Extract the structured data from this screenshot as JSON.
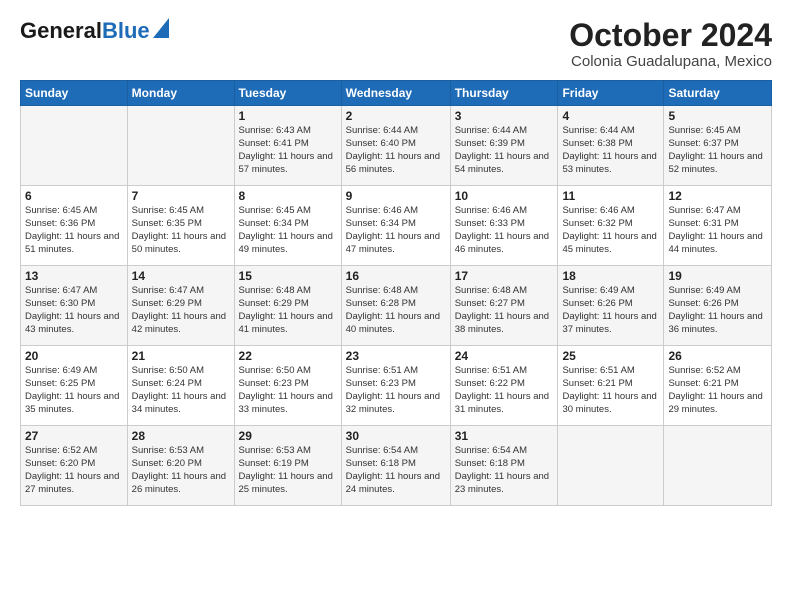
{
  "header": {
    "logo_general": "General",
    "logo_blue": "Blue",
    "main_title": "October 2024",
    "subtitle": "Colonia Guadalupana, Mexico"
  },
  "calendar": {
    "days_of_week": [
      "Sunday",
      "Monday",
      "Tuesday",
      "Wednesday",
      "Thursday",
      "Friday",
      "Saturday"
    ],
    "weeks": [
      [
        {
          "day": "",
          "info": ""
        },
        {
          "day": "",
          "info": ""
        },
        {
          "day": "1",
          "info": "Sunrise: 6:43 AM\nSunset: 6:41 PM\nDaylight: 11 hours and 57 minutes."
        },
        {
          "day": "2",
          "info": "Sunrise: 6:44 AM\nSunset: 6:40 PM\nDaylight: 11 hours and 56 minutes."
        },
        {
          "day": "3",
          "info": "Sunrise: 6:44 AM\nSunset: 6:39 PM\nDaylight: 11 hours and 54 minutes."
        },
        {
          "day": "4",
          "info": "Sunrise: 6:44 AM\nSunset: 6:38 PM\nDaylight: 11 hours and 53 minutes."
        },
        {
          "day": "5",
          "info": "Sunrise: 6:45 AM\nSunset: 6:37 PM\nDaylight: 11 hours and 52 minutes."
        }
      ],
      [
        {
          "day": "6",
          "info": "Sunrise: 6:45 AM\nSunset: 6:36 PM\nDaylight: 11 hours and 51 minutes."
        },
        {
          "day": "7",
          "info": "Sunrise: 6:45 AM\nSunset: 6:35 PM\nDaylight: 11 hours and 50 minutes."
        },
        {
          "day": "8",
          "info": "Sunrise: 6:45 AM\nSunset: 6:34 PM\nDaylight: 11 hours and 49 minutes."
        },
        {
          "day": "9",
          "info": "Sunrise: 6:46 AM\nSunset: 6:34 PM\nDaylight: 11 hours and 47 minutes."
        },
        {
          "day": "10",
          "info": "Sunrise: 6:46 AM\nSunset: 6:33 PM\nDaylight: 11 hours and 46 minutes."
        },
        {
          "day": "11",
          "info": "Sunrise: 6:46 AM\nSunset: 6:32 PM\nDaylight: 11 hours and 45 minutes."
        },
        {
          "day": "12",
          "info": "Sunrise: 6:47 AM\nSunset: 6:31 PM\nDaylight: 11 hours and 44 minutes."
        }
      ],
      [
        {
          "day": "13",
          "info": "Sunrise: 6:47 AM\nSunset: 6:30 PM\nDaylight: 11 hours and 43 minutes."
        },
        {
          "day": "14",
          "info": "Sunrise: 6:47 AM\nSunset: 6:29 PM\nDaylight: 11 hours and 42 minutes."
        },
        {
          "day": "15",
          "info": "Sunrise: 6:48 AM\nSunset: 6:29 PM\nDaylight: 11 hours and 41 minutes."
        },
        {
          "day": "16",
          "info": "Sunrise: 6:48 AM\nSunset: 6:28 PM\nDaylight: 11 hours and 40 minutes."
        },
        {
          "day": "17",
          "info": "Sunrise: 6:48 AM\nSunset: 6:27 PM\nDaylight: 11 hours and 38 minutes."
        },
        {
          "day": "18",
          "info": "Sunrise: 6:49 AM\nSunset: 6:26 PM\nDaylight: 11 hours and 37 minutes."
        },
        {
          "day": "19",
          "info": "Sunrise: 6:49 AM\nSunset: 6:26 PM\nDaylight: 11 hours and 36 minutes."
        }
      ],
      [
        {
          "day": "20",
          "info": "Sunrise: 6:49 AM\nSunset: 6:25 PM\nDaylight: 11 hours and 35 minutes."
        },
        {
          "day": "21",
          "info": "Sunrise: 6:50 AM\nSunset: 6:24 PM\nDaylight: 11 hours and 34 minutes."
        },
        {
          "day": "22",
          "info": "Sunrise: 6:50 AM\nSunset: 6:23 PM\nDaylight: 11 hours and 33 minutes."
        },
        {
          "day": "23",
          "info": "Sunrise: 6:51 AM\nSunset: 6:23 PM\nDaylight: 11 hours and 32 minutes."
        },
        {
          "day": "24",
          "info": "Sunrise: 6:51 AM\nSunset: 6:22 PM\nDaylight: 11 hours and 31 minutes."
        },
        {
          "day": "25",
          "info": "Sunrise: 6:51 AM\nSunset: 6:21 PM\nDaylight: 11 hours and 30 minutes."
        },
        {
          "day": "26",
          "info": "Sunrise: 6:52 AM\nSunset: 6:21 PM\nDaylight: 11 hours and 29 minutes."
        }
      ],
      [
        {
          "day": "27",
          "info": "Sunrise: 6:52 AM\nSunset: 6:20 PM\nDaylight: 11 hours and 27 minutes."
        },
        {
          "day": "28",
          "info": "Sunrise: 6:53 AM\nSunset: 6:20 PM\nDaylight: 11 hours and 26 minutes."
        },
        {
          "day": "29",
          "info": "Sunrise: 6:53 AM\nSunset: 6:19 PM\nDaylight: 11 hours and 25 minutes."
        },
        {
          "day": "30",
          "info": "Sunrise: 6:54 AM\nSunset: 6:18 PM\nDaylight: 11 hours and 24 minutes."
        },
        {
          "day": "31",
          "info": "Sunrise: 6:54 AM\nSunset: 6:18 PM\nDaylight: 11 hours and 23 minutes."
        },
        {
          "day": "",
          "info": ""
        },
        {
          "day": "",
          "info": ""
        }
      ]
    ]
  }
}
